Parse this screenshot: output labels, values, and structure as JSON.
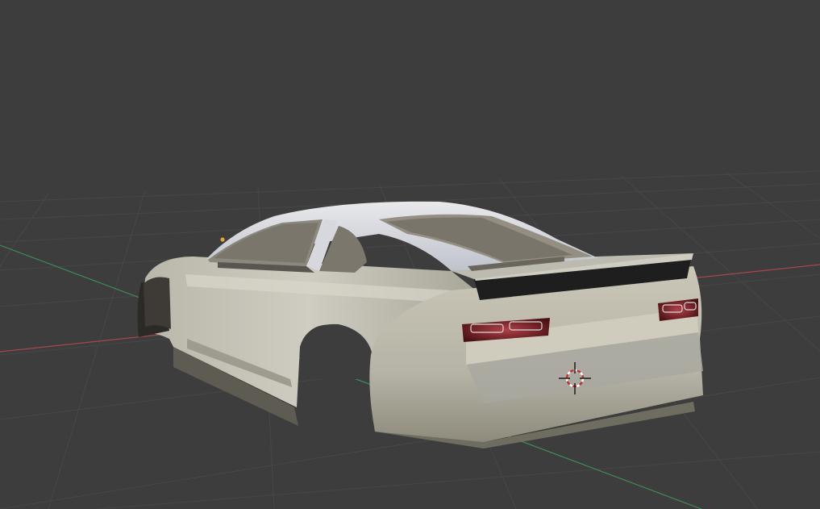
{
  "app": "3D Viewport",
  "viewport": {
    "background_color": "#3d3d3d",
    "grid_color": "#474747",
    "x_axis_color": "#b34a4a",
    "y_axis_color": "#3f8f5a"
  },
  "scene_object": {
    "type": "car body shell",
    "body_color": "#c8c6bc",
    "spoiler_color": "#1c1c1c",
    "taillight_color": "#7a1e22"
  },
  "cursor": {
    "icon": "3d-cursor-icon",
    "ring_color": "#c23030"
  },
  "origin_marker": {
    "icon": "object-origin-dot",
    "color": "#e8a33a"
  }
}
